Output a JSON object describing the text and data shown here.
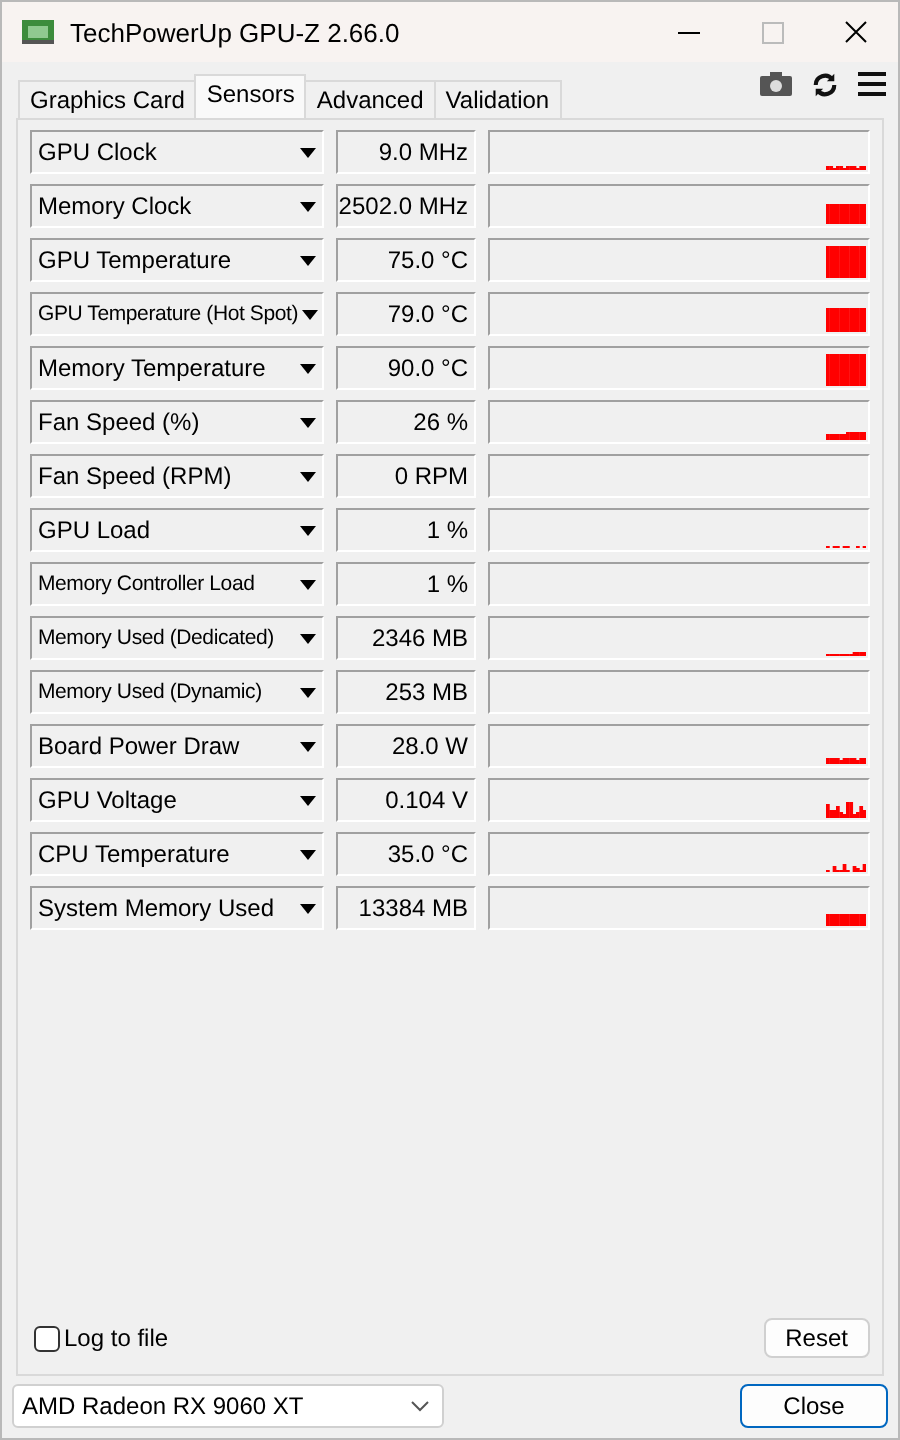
{
  "window": {
    "title": "TechPowerUp GPU-Z 2.66.0"
  },
  "tabs": [
    {
      "label": "Graphics Card",
      "selected": false
    },
    {
      "label": "Sensors",
      "selected": true
    },
    {
      "label": "Advanced",
      "selected": false
    },
    {
      "label": "Validation",
      "selected": false
    }
  ],
  "sensors": [
    {
      "name": "GPU Clock",
      "value": "9.0 MHz"
    },
    {
      "name": "Memory Clock",
      "value": "2502.0 MHz"
    },
    {
      "name": "GPU Temperature",
      "value": "75.0 °C"
    },
    {
      "name": "GPU Temperature (Hot Spot)",
      "value": "79.0 °C"
    },
    {
      "name": "Memory Temperature",
      "value": "90.0 °C"
    },
    {
      "name": "Fan Speed (%)",
      "value": "26 %"
    },
    {
      "name": "Fan Speed (RPM)",
      "value": "0 RPM"
    },
    {
      "name": "GPU Load",
      "value": "1 %"
    },
    {
      "name": "Memory Controller Load",
      "value": "1 %"
    },
    {
      "name": "Memory Used (Dedicated)",
      "value": "2346 MB"
    },
    {
      "name": "Memory Used (Dynamic)",
      "value": "253 MB"
    },
    {
      "name": "Board Power Draw",
      "value": "28.0 W"
    },
    {
      "name": "GPU Voltage",
      "value": "0.104 V"
    },
    {
      "name": "CPU Temperature",
      "value": "35.0 °C"
    },
    {
      "name": "System Memory Used",
      "value": "13384 MB"
    }
  ],
  "log_to_file": {
    "label": "Log to file",
    "checked": false
  },
  "reset_button": "Reset",
  "gpu_select": {
    "value": "AMD Radeon RX 9060 XT"
  },
  "close_button": "Close"
}
